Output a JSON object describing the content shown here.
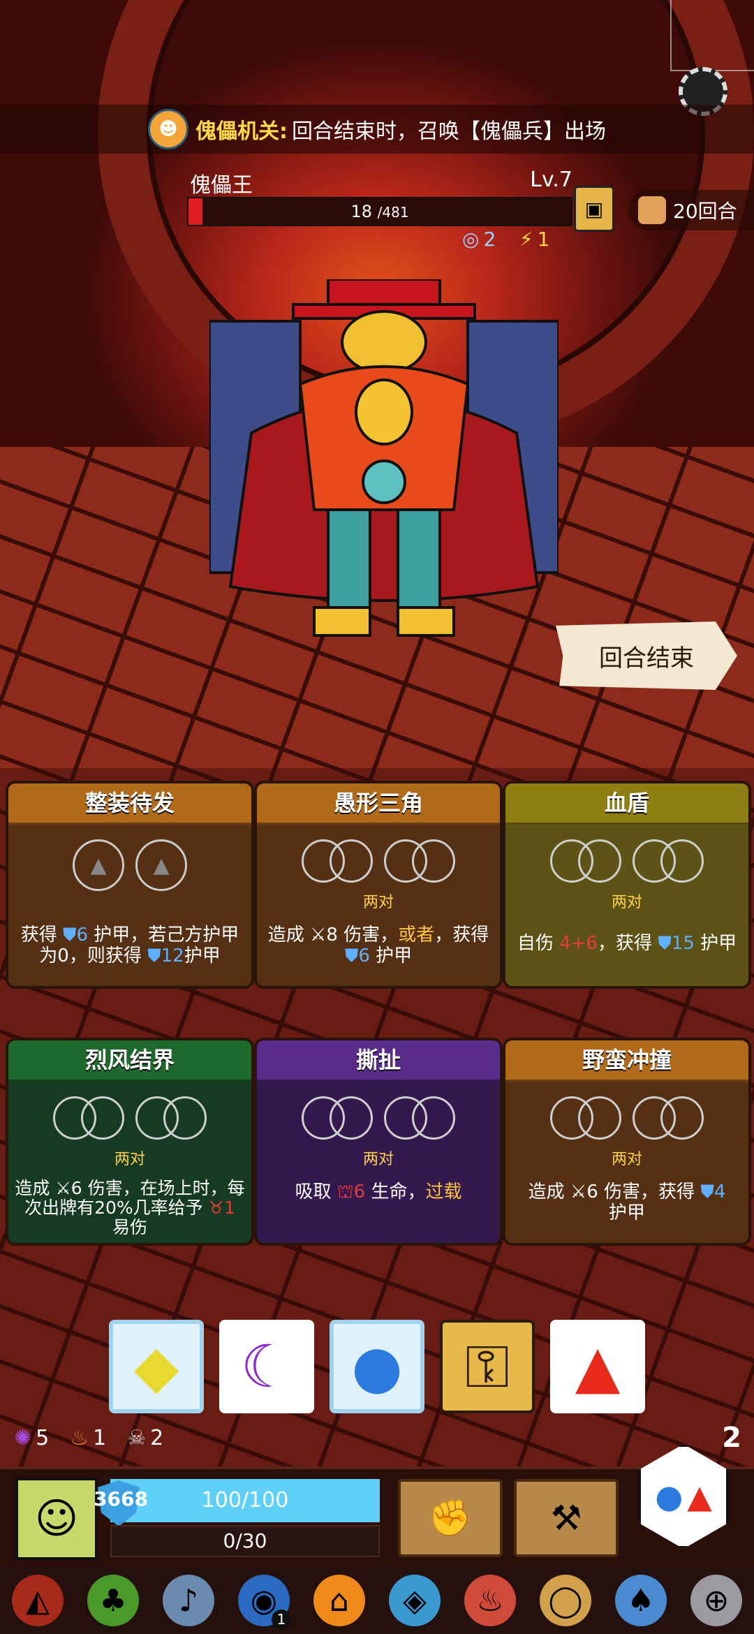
{
  "banner": {
    "icon": "puppet-mask-icon",
    "keyword": "傀儡机关:",
    "text": "回合结束时，召唤【傀儡兵】出场"
  },
  "boss": {
    "name": "傀儡王",
    "level": "Lv.7",
    "hp_current": "18",
    "hp_max": "/481",
    "hp_fraction": 0.0374,
    "status_a": "2",
    "status_b": "1"
  },
  "rounds": {
    "label": "20回合"
  },
  "end_turn": {
    "label": "回合结束"
  },
  "cards": [
    {
      "title": "整装待发",
      "hint": "",
      "desc_a": "获得",
      "armor1": "6",
      "desc_b": "护甲，若己方护甲为0，则获得",
      "armor2": "12",
      "desc_c": "护甲"
    },
    {
      "title": "愚形三角",
      "hint": "两对",
      "desc_a": "造成",
      "dmg": "8",
      "desc_b": "伤害，",
      "or": "或者",
      "desc_c": "，获得",
      "armor": "6",
      "desc_d": "护甲"
    },
    {
      "title": "血盾",
      "hint": "两对",
      "desc_a": "自伤",
      "self": "4+6",
      "desc_b": "，获得",
      "armor": "15",
      "desc_c": "护甲"
    },
    {
      "title": "烈风结界",
      "hint": "两对",
      "desc_a": "造成",
      "dmg": "6",
      "desc_b": "伤害，在场上时，每次出牌有20%几率给予",
      "vuln": "1",
      "desc_c": "易伤"
    },
    {
      "title": "撕扯",
      "hint": "两对",
      "desc_a": "吸取",
      "drain": "6",
      "desc_b": "生命，",
      "over": "过载"
    },
    {
      "title": "野蛮冲撞",
      "hint": "两对",
      "desc_a": "造成",
      "dmg": "6",
      "desc_b": "伤害，获得",
      "armor": "4",
      "desc_c": "护甲"
    }
  ],
  "dice": [
    {
      "icon": "yellow-diamond-icon",
      "glyph": "◆",
      "color": "#e8d830",
      "state": "frozen"
    },
    {
      "icon": "purple-moon-icon",
      "glyph": "☾",
      "color": "#8a2ad0",
      "state": "normal"
    },
    {
      "icon": "blue-drop-icon",
      "glyph": "💧",
      "color": "#2a7ae0",
      "state": "frozen"
    },
    {
      "icon": "keyhole-lock-icon",
      "glyph": "🔒",
      "color": "#2a1a0a",
      "state": "locked"
    },
    {
      "icon": "red-flame-icon",
      "glyph": "🔥",
      "color": "#e82a1a",
      "state": "normal"
    }
  ],
  "resources": {
    "purple": "5",
    "fire": "1",
    "skull": "2"
  },
  "turn_number": "2",
  "player": {
    "shield": "3668",
    "hp": "100/100",
    "xp": "0/30"
  },
  "relic_badge": "1"
}
